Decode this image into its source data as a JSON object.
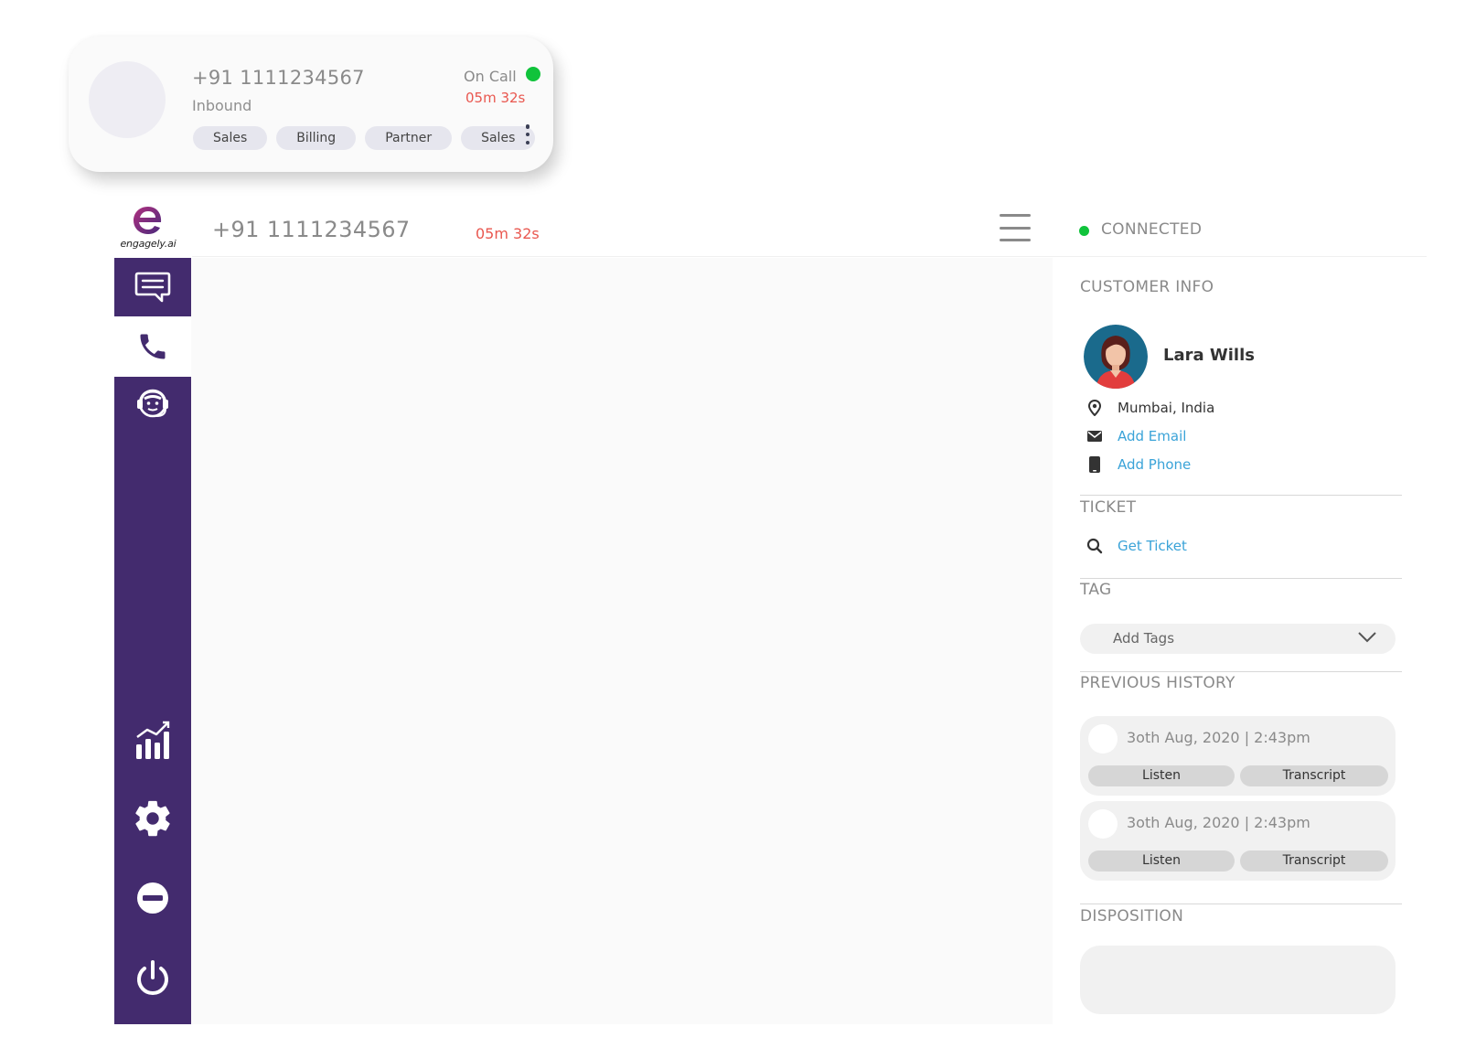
{
  "call_card": {
    "number": "+91 1111234567",
    "direction": "Inbound",
    "status": "On Call",
    "timer": "05m 32s",
    "tags": [
      "Sales",
      "Billing",
      "Partner",
      "Sales"
    ],
    "status_color": "#10c33b"
  },
  "topbar": {
    "brand": "engagely.ai",
    "number": "+91 1111234567",
    "timer": "05m 32s",
    "connection": "CONNECTED"
  },
  "sidebar": {
    "items": [
      {
        "name": "chat",
        "icon": "chat-bubble-icon",
        "active": false
      },
      {
        "name": "phone",
        "icon": "phone-icon",
        "active": true
      },
      {
        "name": "agent",
        "icon": "headset-agent-icon",
        "active": false
      },
      {
        "name": "analytics",
        "icon": "bar-chart-icon",
        "active": false
      },
      {
        "name": "settings",
        "icon": "gear-icon",
        "active": false
      },
      {
        "name": "status",
        "icon": "minus-circle-icon",
        "active": false
      },
      {
        "name": "logout",
        "icon": "power-icon",
        "active": false
      }
    ],
    "bg_color": "#432b6e"
  },
  "customer": {
    "section_title": "CUSTOMER INFO",
    "name": "Lara Wills",
    "location": "Mumbai, India",
    "add_email": "Add Email",
    "add_phone": "Add Phone"
  },
  "ticket": {
    "section_title": "TICKET",
    "get_ticket": "Get Ticket"
  },
  "tag": {
    "section_title": "TAG",
    "placeholder": "Add Tags"
  },
  "history": {
    "section_title": "PREVIOUS HISTORY",
    "items": [
      {
        "date": "3oth Aug, 2020  |  2:43pm",
        "listen": "Listen",
        "transcript": "Transcript"
      },
      {
        "date": "3oth Aug, 2020  |  2:43pm",
        "listen": "Listen",
        "transcript": "Transcript"
      }
    ]
  },
  "disposition": {
    "section_title": "DISPOSITION"
  },
  "colors": {
    "accent_link": "#3aa3d8",
    "timer": "#e9574f",
    "connected": "#10c33b"
  }
}
